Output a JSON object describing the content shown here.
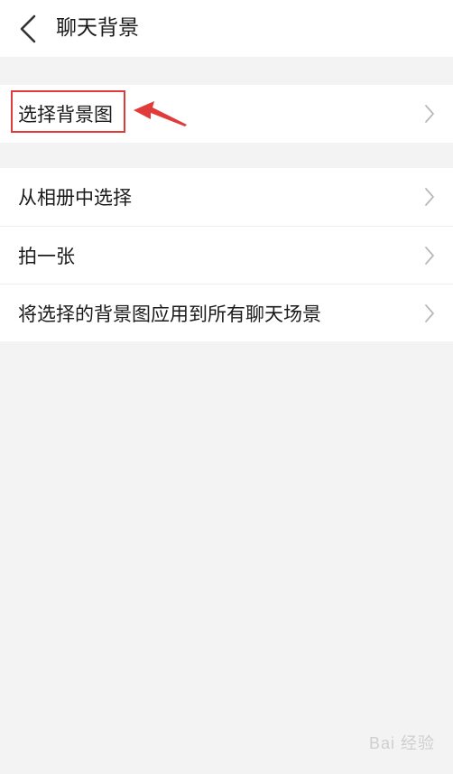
{
  "header": {
    "back_icon": "chevron-left-icon",
    "title": "聊天背景"
  },
  "section1": {
    "items": [
      {
        "label": "选择背景图",
        "icon": "chevron-right-icon"
      }
    ]
  },
  "section2": {
    "items": [
      {
        "label": "从相册中选择",
        "icon": "chevron-right-icon"
      },
      {
        "label": "拍一张",
        "icon": "chevron-right-icon"
      },
      {
        "label": "将选择的背景图应用到所有聊天场景",
        "icon": "chevron-right-icon"
      }
    ]
  },
  "annotation": {
    "color": "#e03a3a"
  },
  "watermark": {
    "text": "Bai 经验"
  }
}
